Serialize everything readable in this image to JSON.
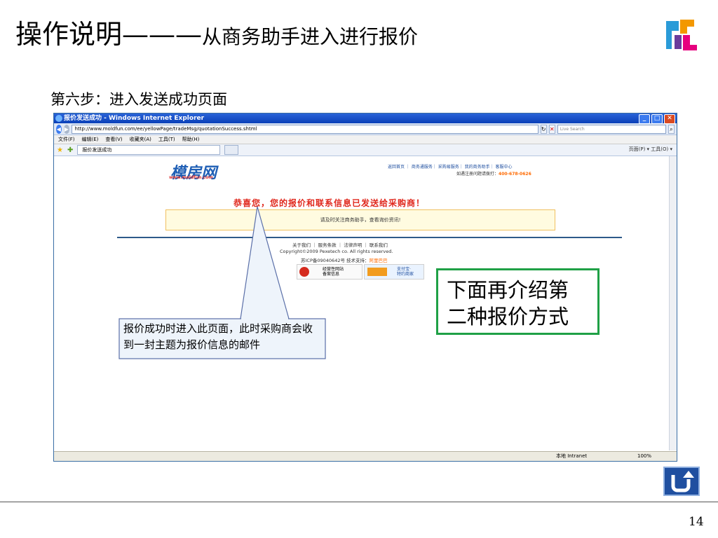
{
  "slide": {
    "title_main": "操作说明———",
    "title_sub": "从商务助手进入进行报价",
    "step": "第六步：进入发送成功页面",
    "green_box": [
      "下面再介绍第",
      "二种报价方式"
    ],
    "callout": "报价成功时进入此页面，此时采购商会收到一封主题为报价信息的邮件",
    "page_number": "14"
  },
  "browser": {
    "window_title": "报价发送成功 - Windows Internet Explorer",
    "url": "http://www.moldfun.com/ee/yellowPage/tradeMsg/quotationSuccess.shtml",
    "search_placeholder": "Live Search",
    "menu": [
      "文件(F)",
      "编辑(E)",
      "查看(V)",
      "收藏夹(A)",
      "工具(T)",
      "帮助(H)"
    ],
    "tab_label": "报价发送成功",
    "command_bar": "页面(P) ▾  工具(O) ▾",
    "status_zone": "本地 Intranet",
    "status_zoom": "100%"
  },
  "site": {
    "logo": "模房网",
    "logo_url": "www.moldfun.com",
    "top_links": "返回首页 ｜ 商务通服务｜ 采购易服务｜ 我的商务助手｜ 客服中心",
    "hotline_label": "如遇注册问题请拨打：",
    "hotline": "400-678-0626",
    "congrats": "恭喜您，您的报价和联系信息已发送给采购商！",
    "notice": "请及时关注商务助手，查看询价资讯!",
    "footer_links": "关于我们 ｜ 服务条款 ｜ 法律声明 ｜ 联系我们",
    "copyright": "Copyright©2009 Pexetech co. All rights reserved.",
    "icp_label": "苏ICP备09040642号 技术支持：",
    "icp_support": "阿里巴巴",
    "badge1": [
      "经营性网站",
      "备案信息"
    ],
    "badge2": [
      "支付宝·",
      "特约商家"
    ]
  }
}
